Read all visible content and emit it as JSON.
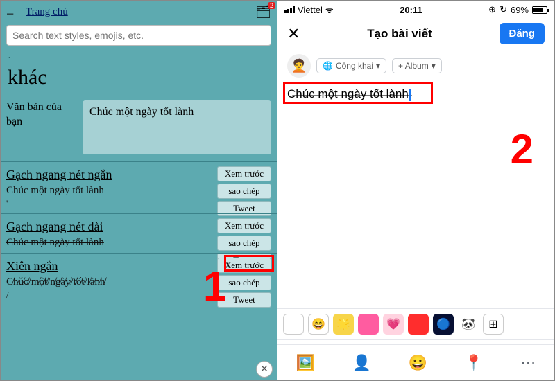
{
  "left": {
    "home_link": "Trang chủ",
    "notif_badge": "2",
    "search_placeholder": "Search text styles, emojis, etc.",
    "big_title": "khác",
    "your_text_label": "Văn bản của bạn",
    "your_text_value": "Chúc một ngày tốt lành",
    "styles": [
      {
        "name": "Gạch ngang nét ngắn",
        "sample": "Chúc một ngày tốt lành",
        "sample_style": "strike-short",
        "extra": "'"
      },
      {
        "name": "Gạch ngang nét dài",
        "sample": "Chúc một ngày tốt lành",
        "sample_style": "strike-long",
        "extra": ""
      },
      {
        "name": "Xiên ngắn",
        "sample": "C̸h̸ú̸c̸/m̸ộ̸t̸/n̸g̸à̸y̸/t̸ố̸t̸/l̸à̸n̸h̸",
        "sample_style": "",
        "extra": "/"
      }
    ],
    "btn_preview": "Xem trước",
    "btn_copy": "sao chép",
    "btn_tweet": "Tweet",
    "big_number": "1"
  },
  "right": {
    "carrier": "Viettel",
    "wifi": "⚬",
    "time": "20:11",
    "alarm": "⏰",
    "battery_pct": "69%",
    "close": "✕",
    "title": "Tạo bài viết",
    "post": "Đăng",
    "avatar": "🧑‍🦱",
    "privacy_label": "Công khai",
    "album_label": "+ Album",
    "compose_text": "C̶h̶ú̶c̶ ̶m̶ộ̶t̶ ̶n̶g̶à̶y̶ ̶t̶ố̶t̶ ̶l̶à̶n̶h̶",
    "big_number": "2",
    "bg_items": [
      {
        "c": "#fff",
        "b": "1px solid #ccc",
        "t": ""
      },
      {
        "c": "#fff",
        "b": "1px solid #ccc",
        "t": "😄"
      },
      {
        "c": "#f7d54a",
        "b": "",
        "t": "🌟"
      },
      {
        "c": "#ff5ca0",
        "b": "",
        "t": ""
      },
      {
        "c": "#ffd3e0",
        "b": "",
        "t": "💗"
      },
      {
        "c": "#ff2d2d",
        "b": "",
        "t": ""
      },
      {
        "c": "#071033",
        "b": "",
        "t": "🔵"
      },
      {
        "c": "#fff",
        "b": "",
        "t": "🐼"
      },
      {
        "c": "#fff",
        "b": "1px solid #ccc",
        "t": "⊞"
      }
    ],
    "actions": [
      {
        "icon": "🖼️",
        "color": "#45bd62",
        "name": "photo"
      },
      {
        "icon": "👤",
        "color": "#1877f2",
        "name": "tag-people"
      },
      {
        "icon": "😀",
        "color": "#f7b928",
        "name": "feeling"
      },
      {
        "icon": "📍",
        "color": "#f5533d",
        "name": "location"
      },
      {
        "icon": "⋯",
        "color": "#606770",
        "name": "more"
      }
    ]
  }
}
